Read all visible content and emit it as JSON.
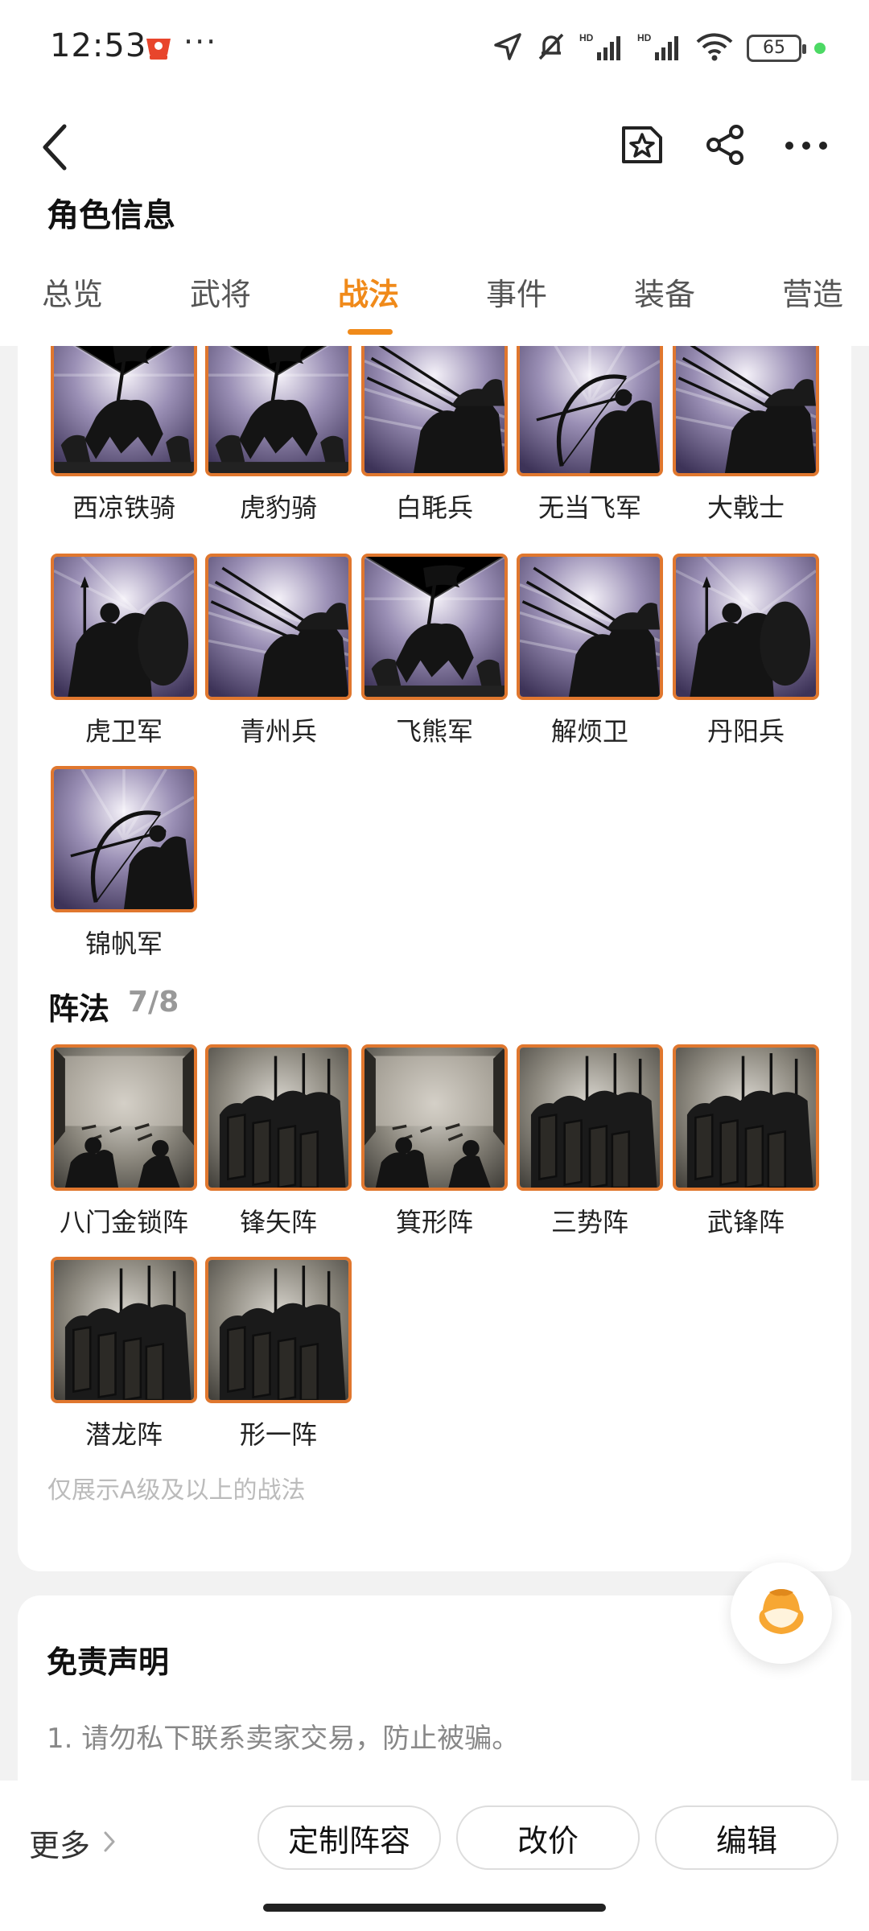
{
  "status_bar": {
    "time": "12:53",
    "dots": "···",
    "battery": "65"
  },
  "header": {
    "title": "角色信息"
  },
  "tabs": [
    {
      "label": "总览"
    },
    {
      "label": "武将"
    },
    {
      "label": "战法"
    },
    {
      "label": "事件"
    },
    {
      "label": "装备"
    },
    {
      "label": "营造"
    }
  ],
  "troops": [
    {
      "label": "西凉铁骑",
      "icon": "flag-cavalry-icon"
    },
    {
      "label": "虎豹骑",
      "icon": "flag-cavalry-icon"
    },
    {
      "label": "白毦兵",
      "icon": "spear-troops-icon"
    },
    {
      "label": "无当飞军",
      "icon": "archer-icon"
    },
    {
      "label": "大戟士",
      "icon": "spear-troops-icon"
    },
    {
      "label": "虎卫军",
      "icon": "shield-troops-icon"
    },
    {
      "label": "青州兵",
      "icon": "spear-troops-icon"
    },
    {
      "label": "飞熊军",
      "icon": "flag-cavalry-icon"
    },
    {
      "label": "解烦卫",
      "icon": "spear-troops-icon"
    },
    {
      "label": "丹阳兵",
      "icon": "shield-troops-icon"
    },
    {
      "label": "锦帆军",
      "icon": "archer-icon"
    }
  ],
  "formations": {
    "title": "阵法",
    "count": "7/8",
    "items": [
      {
        "label": "八门金锁阵",
        "icon": "tent-war-council-icon"
      },
      {
        "label": "锋矢阵",
        "icon": "shield-wall-icon"
      },
      {
        "label": "箕形阵",
        "icon": "tent-war-council-icon"
      },
      {
        "label": "三势阵",
        "icon": "shield-wall-icon"
      },
      {
        "label": "武锋阵",
        "icon": "shield-wall-icon"
      },
      {
        "label": "潜龙阵",
        "icon": "shield-wall-icon"
      },
      {
        "label": "形一阵",
        "icon": "shield-wall-icon"
      }
    ]
  },
  "note": "仅展示A级及以上的战法",
  "disclaimer": {
    "title": "免责声明",
    "items": [
      "1.  请勿私下联系卖家交易，防止被骗。"
    ]
  },
  "bottom_bar": {
    "more_label": "更多",
    "buttons": [
      "定制阵容",
      "改价",
      "编辑"
    ]
  },
  "colors": {
    "accent": "#f08a1a",
    "thumb_border": "#e0772e"
  }
}
